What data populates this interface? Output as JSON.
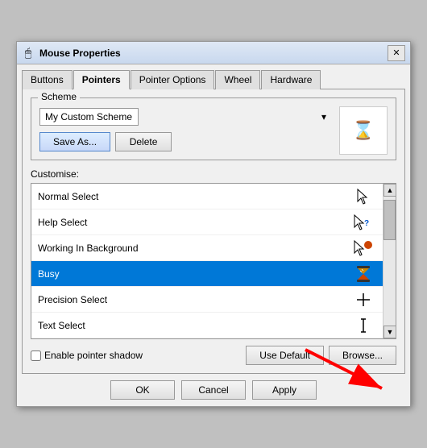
{
  "window": {
    "title": "Mouse Properties",
    "icon": "🖱"
  },
  "tabs": [
    {
      "label": "Buttons",
      "active": false
    },
    {
      "label": "Pointers",
      "active": true
    },
    {
      "label": "Pointer Options",
      "active": false
    },
    {
      "label": "Wheel",
      "active": false
    },
    {
      "label": "Hardware",
      "active": false
    }
  ],
  "scheme": {
    "label": "Scheme",
    "value": "My Custom Scheme",
    "save_label": "Save As...",
    "delete_label": "Delete"
  },
  "customise": {
    "label": "Customise:",
    "items": [
      {
        "name": "Normal Select",
        "icon": "arrow",
        "selected": false
      },
      {
        "name": "Help Select",
        "icon": "help",
        "selected": false
      },
      {
        "name": "Working In Background",
        "icon": "working",
        "selected": false
      },
      {
        "name": "Busy",
        "icon": "busy",
        "selected": true
      },
      {
        "name": "Precision Select",
        "icon": "precision",
        "selected": false
      },
      {
        "name": "Text Select",
        "icon": "text",
        "selected": false
      }
    ],
    "shadow_label": "Enable pointer shadow",
    "use_default_label": "Use Default",
    "browse_label": "Browse..."
  },
  "footer": {
    "ok_label": "OK",
    "cancel_label": "Cancel",
    "apply_label": "Apply"
  }
}
